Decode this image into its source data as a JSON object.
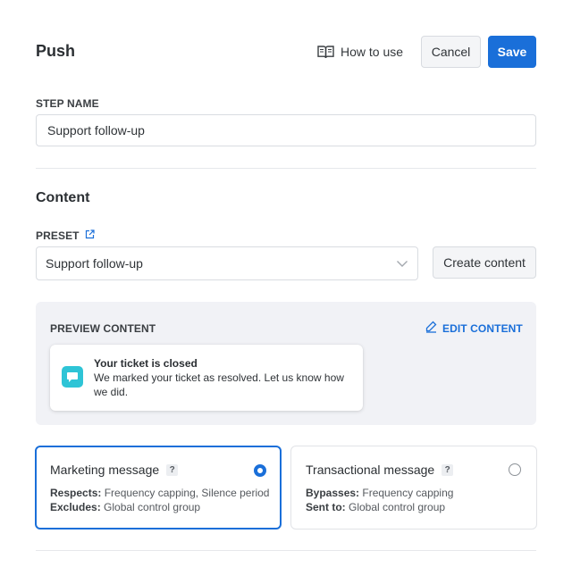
{
  "header": {
    "title": "Push",
    "how_to_use": "How to use",
    "cancel": "Cancel",
    "save": "Save"
  },
  "step": {
    "label": "STEP NAME",
    "value": "Support follow-up"
  },
  "content": {
    "title": "Content",
    "preset_label": "PRESET",
    "preset_value": "Support follow-up",
    "create_button": "Create content"
  },
  "preview": {
    "label": "PREVIEW CONTENT",
    "edit": "EDIT CONTENT",
    "notification_title": "Your ticket is closed",
    "notification_body": "We marked your ticket as resolved. Let us know how we did."
  },
  "message_types": [
    {
      "title": "Marketing message",
      "help": "?",
      "line1_key": "Respects:",
      "line1_val": " Frequency capping, Silence period",
      "line2_key": "Excludes:",
      "line2_val": " Global control group",
      "selected": true
    },
    {
      "title": "Transactional message",
      "help": "?",
      "line1_key": "Bypasses:",
      "line1_val": " Frequency capping",
      "line2_key": "Sent to:",
      "line2_val": " Global control group",
      "selected": false
    }
  ],
  "colors": {
    "accent": "#1a6fd9",
    "notification_icon": "#2ec4d6",
    "preview_bg": "#f1f2f6"
  },
  "icons": [
    "book-icon",
    "external-link-icon",
    "chevron-down-icon",
    "edit-pencil-icon",
    "chat-bubble-icon"
  ]
}
